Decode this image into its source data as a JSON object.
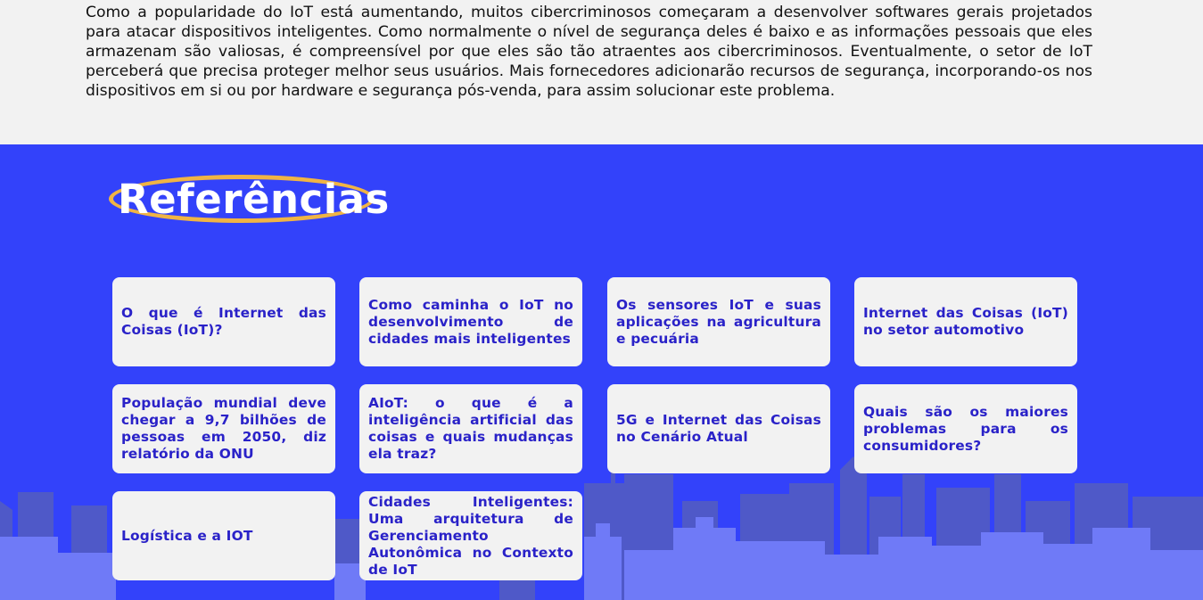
{
  "intro": {
    "paragraph": "Como a popularidade do IoT está aumentando, muitos cibercriminosos começaram a desenvolver softwares gerais projetados para atacar dispositivos inteligentes. Como normalmente o nível de segurança deles é baixo e as informações pessoais que eles armazenam são valiosas, é compreensível por que eles são tão atraentes aos cibercriminosos. Eventualmente, o setor de IoT perceberá que precisa proteger melhor seus usuários. Mais fornecedores adicionarão recursos de segurança, incorporando-os nos dispositivos em si ou por hardware e segurança pós-venda, para assim solucionar este problema."
  },
  "references": {
    "title": "Referências",
    "items": [
      {
        "label": "O que é Internet das Coisas (IoT)?"
      },
      {
        "label": "Como caminha o IoT no desenvolvimento de cidades mais inteligentes"
      },
      {
        "label": "Os sensores IoT e suas aplicações na agricultura e pecuária"
      },
      {
        "label": "Internet das Coisas (IoT) no setor automotivo"
      },
      {
        "label": "População mundial deve chegar a 9,7 bilhões de pessoas em 2050, diz relatório da ONU"
      },
      {
        "label": "AIoT: o que é a inteligência artificial das coisas e quais mudanças ela traz?"
      },
      {
        "label": "5G e Internet das Coisas no Cenário Atual"
      },
      {
        "label": "Quais são os maiores problemas para os consumidores?"
      },
      {
        "label": "Logística e a IOT"
      },
      {
        "label": "Cidades Inteligentes: Uma arquitetura de Gerenciamento Autonômica no Contexto de IoT"
      }
    ]
  },
  "colors": {
    "section_background": "#3342fa",
    "skyline_back": "#4f59c8",
    "skyline_front": "#6f7af7",
    "title_ellipse": "#f0b444",
    "card_background": "#f2f2f2",
    "link_text": "#2a22c8"
  }
}
